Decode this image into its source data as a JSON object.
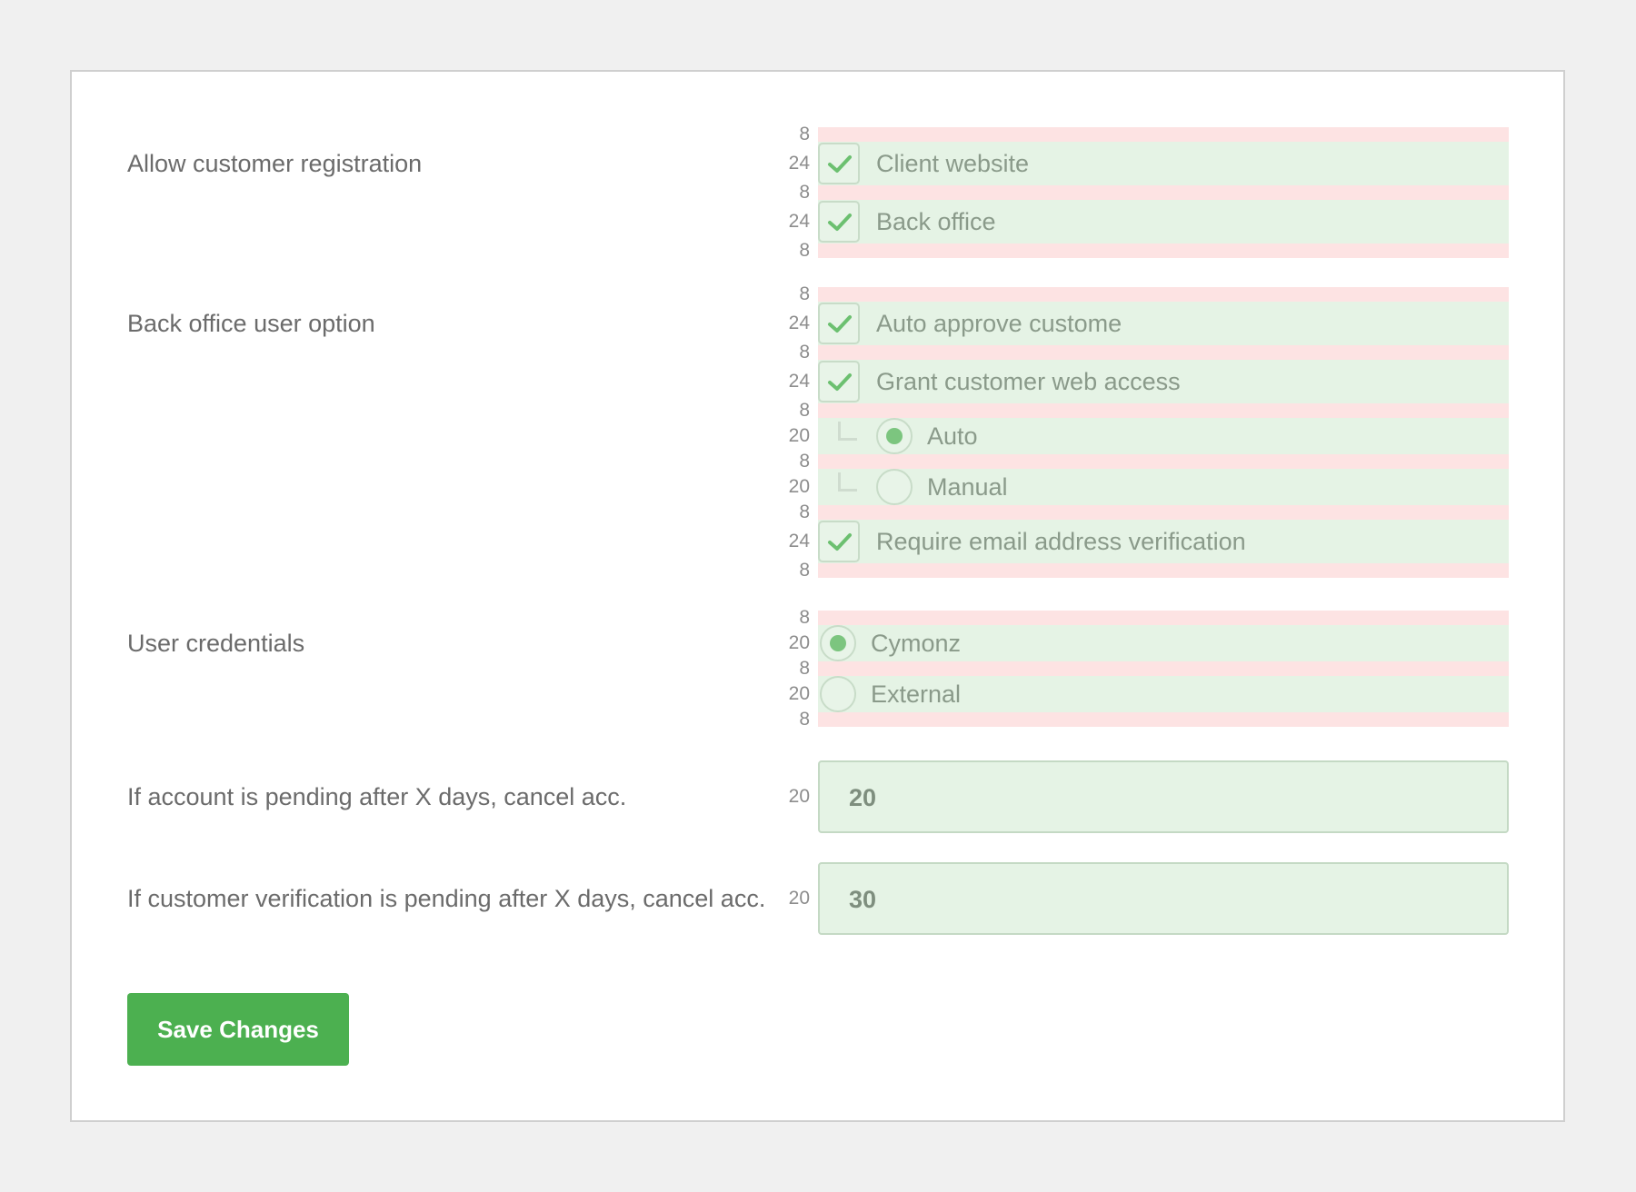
{
  "rows": {
    "registration": {
      "label": "Allow customer registration",
      "options": [
        "Client website",
        "Back office"
      ]
    },
    "back_office": {
      "label": "Back office user option",
      "options": [
        "Auto approve custome",
        "Grant customer web access",
        "Auto",
        "Manual",
        "Require email address verification"
      ]
    },
    "credentials": {
      "label": "User credentials",
      "options": [
        "Cymonz",
        "External"
      ]
    },
    "pending_account": {
      "label": "If account is pending after X days, cancel acc.",
      "value": "20"
    },
    "pending_verification": {
      "label": "If customer verification is pending after X days, cancel acc.",
      "value": "30"
    }
  },
  "spacing": {
    "gap": "8",
    "checkbox": "24",
    "radio": "20",
    "field": "20"
  },
  "save_label": "Save Changes",
  "colors": {
    "accent": "#4cb050",
    "spacing_band": "#fde3e3",
    "content_band": "#e5f3e5"
  }
}
